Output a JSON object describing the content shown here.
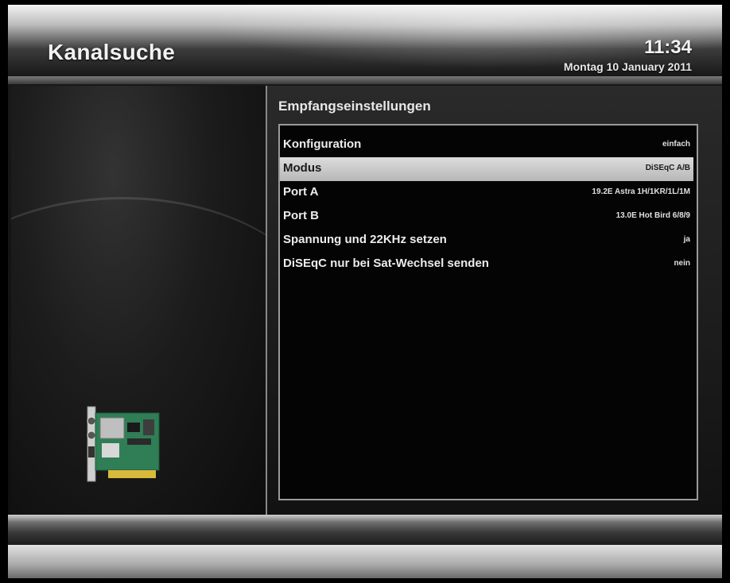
{
  "header": {
    "title": "Kanalsuche",
    "time": "11:34",
    "date": "Montag 10 January 2011"
  },
  "section": {
    "title": "Empfangseinstellungen"
  },
  "menu": {
    "items": [
      {
        "label": "Konfiguration",
        "value": "einfach"
      },
      {
        "label": "Modus",
        "value": "DiSEqC A/B",
        "selected": true
      },
      {
        "label": "Port A",
        "value": "19.2E Astra 1H/1KR/1L/1M"
      },
      {
        "label": "Port B",
        "value": "13.0E Hot Bird 6/8/9"
      },
      {
        "label": "Spannung und 22KHz setzen",
        "value": "ja"
      },
      {
        "label": "DiSEqC nur bei Sat-Wechsel senden",
        "value": "nein"
      }
    ]
  },
  "icons": {
    "tuner_card": "tuner-card-icon"
  },
  "colors": {
    "selection": "#c8c8c8",
    "text": "#ececec",
    "background": "#040404"
  }
}
